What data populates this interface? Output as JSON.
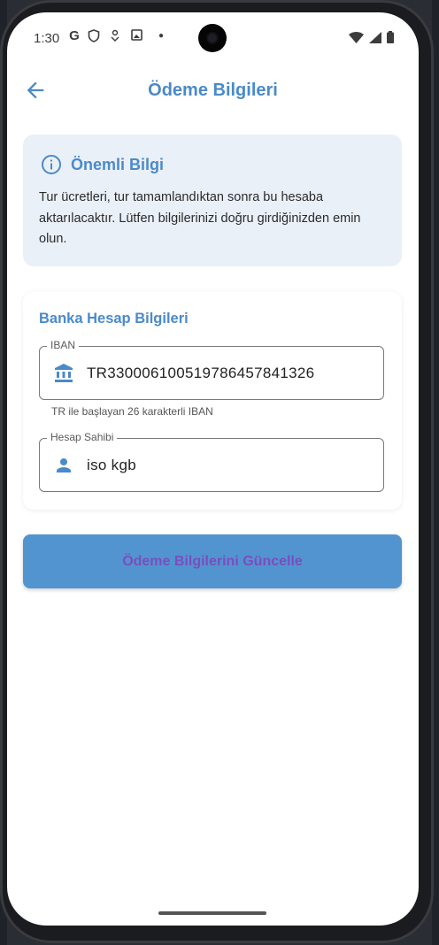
{
  "status_bar": {
    "time": "1:30",
    "left_icons": [
      "google-g-icon",
      "shield-icon",
      "location-icon",
      "photo-icon",
      "dot-icon"
    ],
    "right_icons": [
      "wifi-icon",
      "signal-icon",
      "battery-icon"
    ]
  },
  "app_bar": {
    "title": "Ödeme Bilgileri",
    "back_icon": "arrow-left-icon"
  },
  "info_card": {
    "icon": "info-icon",
    "title": "Önemli Bilgi",
    "text": "Tur ücretleri, tur tamamlandıktan sonra bu hesaba aktarılacaktır. Lütfen bilgilerinizi doğru girdiğinizden emin olun."
  },
  "bank_card": {
    "title": "Banka Hesap Bilgileri",
    "iban": {
      "label": "IBAN",
      "value": "TR330006100519786457841326",
      "helper": "TR ile başlayan 26 karakterli IBAN",
      "icon": "bank-icon"
    },
    "holder": {
      "label": "Hesap Sahibi",
      "value": "iso kgb",
      "icon": "person-icon"
    }
  },
  "submit_button": {
    "label": "Ödeme Bilgilerini Güncelle"
  },
  "colors": {
    "primary": "#4a8ac9",
    "info_bg": "#eaf0f8",
    "button_bg": "#5294d0",
    "button_text": "#7c4dbe"
  }
}
